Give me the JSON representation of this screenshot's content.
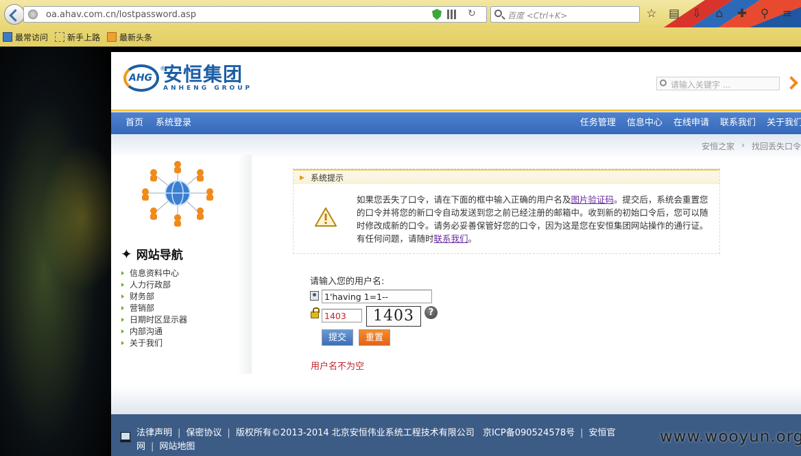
{
  "browser": {
    "url": "oa.ahav.com.cn/lostpassword.asp",
    "search_placeholder": "百度 <Ctrl+K>",
    "bookmarks": [
      {
        "label": "最常访问",
        "icon": "bookmark-folder-icon"
      },
      {
        "label": "新手上路",
        "icon": "page-icon"
      },
      {
        "label": "最新头条",
        "icon": "rss-feed-icon"
      }
    ]
  },
  "site": {
    "logo_cn": "安恒集团",
    "logo_en": "ANHENG GROUP",
    "logo_mark": "AHG",
    "search_placeholder": "请输入关键字 ..."
  },
  "nav": {
    "left": [
      "首页",
      "系统登录"
    ],
    "right": [
      "任务管理",
      "信息中心",
      "在线申请",
      "联系我们",
      "关于我们"
    ]
  },
  "breadcrumb": [
    "安恒之家",
    "›",
    "找回丢失口令"
  ],
  "sidebar": {
    "title": "网站导航",
    "items": [
      "信息资料中心",
      "人力行政部",
      "财务部",
      "营销部",
      "日期时区显示器",
      "内部沟通",
      "关于我们"
    ]
  },
  "notice": {
    "title": "系统提示",
    "text1": "如果您丢失了口令，请在下面的框中输入正确的用户名及",
    "link1": "图片验证码",
    "text2": "。提交后，系统会重置您的口令并将您的新口令自动发送到您之前已经注册的邮箱中。收到新的初始口令后，您可以随时修改成新的口令。请务必妥善保管好您的口令，因为这是您在安恒集团网站操作的通行证。有任何问题，请随时",
    "link2": "联系我们",
    "text3": "。"
  },
  "form": {
    "label": "请输入您的用户名:",
    "username_value": "1'having 1=1--",
    "code_value": "1403",
    "captcha_text": "1403",
    "help": "?",
    "submit_label": "提交",
    "reset_label": "重置",
    "error": "用户名不为空"
  },
  "footer": {
    "line1": [
      "法律声明",
      "保密协议",
      "版权所有©2013-2014 北京安恒伟业系统工程技术有限公司",
      "京ICP备090524578号",
      "安恒官"
    ],
    "line2": [
      "网",
      "网站地图"
    ],
    "watermark": "www.wooyun.org"
  },
  "colors": {
    "nav_bar": "#3f72c1",
    "accent_orange": "#f08a1a",
    "footer": "#3c5c86",
    "error": "#c0252a",
    "link": "#6a2aa0"
  }
}
